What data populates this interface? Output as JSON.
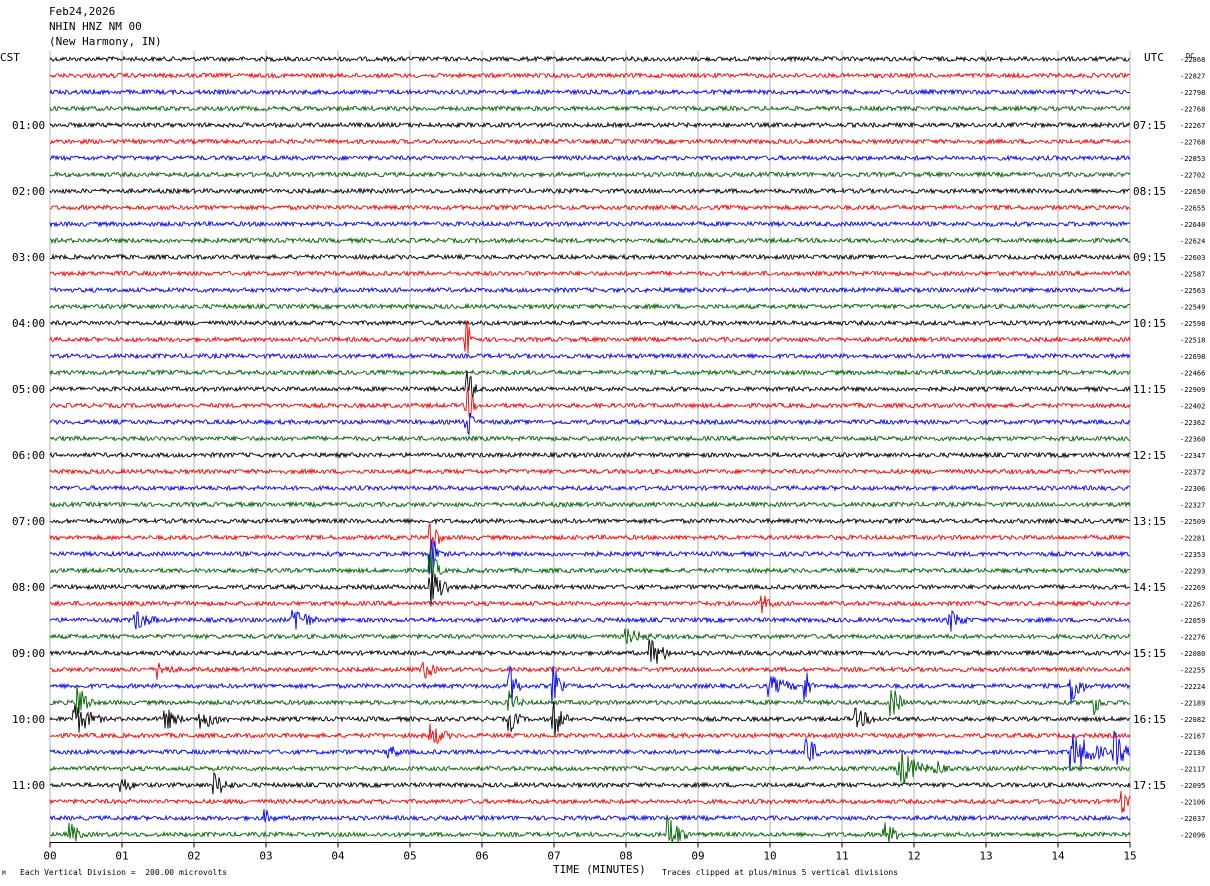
{
  "header": {
    "date": "Feb24,2026",
    "station": "NHIN HNZ NM 00",
    "location": "(New Harmony, IN)"
  },
  "left_zone_label": "CST",
  "right_zone_label": "UTC",
  "dc_label": "DC",
  "footer": {
    "scale_note": "Each Vertical Division =  200.00 microvolts",
    "clip_note": "Traces clipped at plus/minus 5 vertical divisions",
    "corner_mark": "M"
  },
  "colors": {
    "trace_cycle": [
      "#000000",
      "#ff0000",
      "#0000ff",
      "#006400"
    ],
    "grid": "#a0a0a0"
  },
  "chart_data": {
    "type": "line",
    "subtype": "helicorder",
    "xlabel": "TIME (MINUTES)",
    "xlim": [
      0,
      15
    ],
    "x_tick_labels": [
      "00",
      "01",
      "02",
      "03",
      "04",
      "05",
      "06",
      "07",
      "08",
      "09",
      "10",
      "11",
      "12",
      "13",
      "14",
      "15"
    ],
    "rows_per_hour": 4,
    "minutes_per_row": 15,
    "left_time_labels": [
      {
        "row": 4,
        "label": "01:00"
      },
      {
        "row": 8,
        "label": "02:00"
      },
      {
        "row": 12,
        "label": "03:00"
      },
      {
        "row": 16,
        "label": "04:00"
      },
      {
        "row": 20,
        "label": "05:00"
      },
      {
        "row": 24,
        "label": "06:00"
      },
      {
        "row": 28,
        "label": "07:00"
      },
      {
        "row": 32,
        "label": "08:00"
      },
      {
        "row": 36,
        "label": "09:00"
      },
      {
        "row": 40,
        "label": "10:00"
      },
      {
        "row": 44,
        "label": "11:00"
      }
    ],
    "right_time_labels": [
      {
        "row": 4,
        "label": "07:15"
      },
      {
        "row": 8,
        "label": "08:15"
      },
      {
        "row": 12,
        "label": "09:15"
      },
      {
        "row": 16,
        "label": "10:15"
      },
      {
        "row": 20,
        "label": "11:15"
      },
      {
        "row": 24,
        "label": "12:15"
      },
      {
        "row": 28,
        "label": "13:15"
      },
      {
        "row": 32,
        "label": "14:15"
      },
      {
        "row": 36,
        "label": "15:15"
      },
      {
        "row": 40,
        "label": "16:15"
      },
      {
        "row": 44,
        "label": "17:15"
      }
    ],
    "dc_offsets": [
      "-22868",
      "-22827",
      "-22798",
      "-22768",
      "-22267",
      "-22768",
      "-22853",
      "-22702",
      "-22650",
      "-22655",
      "-22640",
      "-22624",
      "-22603",
      "-22587",
      "-22563",
      "-22549",
      "-22598",
      "-22518",
      "-22698",
      "-22466",
      "-22909",
      "-22402",
      "-22362",
      "-22360",
      "-22347",
      "-22372",
      "-22306",
      "-22327",
      "-22509",
      "-22281",
      "-22353",
      "-22293",
      "-22269",
      "-22267",
      "-22059",
      "-22276",
      "-22080",
      "-22255",
      "-22224",
      "-22189",
      "-22082",
      "-22167",
      "-22136",
      "-22117",
      "-22095",
      "-22106",
      "-22037",
      "-22096"
    ],
    "events": [
      {
        "row": 17,
        "minute": 5.8,
        "amp_div": 5,
        "dur_min": 0.12
      },
      {
        "row": 20,
        "minute": 5.8,
        "amp_div": 5,
        "dur_min": 0.15
      },
      {
        "row": 21,
        "minute": 5.8,
        "amp_div": 5,
        "dur_min": 0.12
      },
      {
        "row": 22,
        "minute": 5.8,
        "amp_div": 5,
        "dur_min": 0.1
      },
      {
        "row": 29,
        "minute": 5.3,
        "amp_div": 5,
        "dur_min": 0.15
      },
      {
        "row": 30,
        "minute": 5.3,
        "amp_div": 5,
        "dur_min": 0.15
      },
      {
        "row": 31,
        "minute": 5.3,
        "amp_div": 5,
        "dur_min": 0.15
      },
      {
        "row": 32,
        "minute": 5.3,
        "amp_div": 5,
        "dur_min": 0.3
      },
      {
        "row": 33,
        "minute": 9.9,
        "amp_div": 2.5,
        "dur_min": 0.2
      },
      {
        "row": 34,
        "minute": 1.2,
        "amp_div": 2.5,
        "dur_min": 0.4
      },
      {
        "row": 34,
        "minute": 3.4,
        "amp_div": 4,
        "dur_min": 0.3
      },
      {
        "row": 34,
        "minute": 12.5,
        "amp_div": 3,
        "dur_min": 0.3
      },
      {
        "row": 35,
        "minute": 8.0,
        "amp_div": 2,
        "dur_min": 0.6
      },
      {
        "row": 36,
        "minute": 8.35,
        "amp_div": 4,
        "dur_min": 0.3
      },
      {
        "row": 37,
        "minute": 1.5,
        "amp_div": 2.5,
        "dur_min": 0.3
      },
      {
        "row": 37,
        "minute": 5.2,
        "amp_div": 3,
        "dur_min": 0.2
      },
      {
        "row": 38,
        "minute": 6.4,
        "amp_div": 5,
        "dur_min": 0.15
      },
      {
        "row": 38,
        "minute": 7.0,
        "amp_div": 5,
        "dur_min": 0.15
      },
      {
        "row": 38,
        "minute": 10.0,
        "amp_div": 2.5,
        "dur_min": 0.5
      },
      {
        "row": 38,
        "minute": 10.5,
        "amp_div": 5,
        "dur_min": 0.1
      },
      {
        "row": 38,
        "minute": 14.2,
        "amp_div": 5,
        "dur_min": 0.2
      },
      {
        "row": 39,
        "minute": 0.4,
        "amp_div": 5,
        "dur_min": 0.2
      },
      {
        "row": 39,
        "minute": 6.4,
        "amp_div": 3,
        "dur_min": 0.2
      },
      {
        "row": 39,
        "minute": 11.7,
        "amp_div": 4,
        "dur_min": 0.2
      },
      {
        "row": 39,
        "minute": 14.5,
        "amp_div": 3,
        "dur_min": 0.2
      },
      {
        "row": 40,
        "minute": 0.35,
        "amp_div": 4,
        "dur_min": 0.4
      },
      {
        "row": 40,
        "minute": 1.6,
        "amp_div": 3,
        "dur_min": 0.3
      },
      {
        "row": 40,
        "minute": 2.1,
        "amp_div": 2.5,
        "dur_min": 0.5
      },
      {
        "row": 40,
        "minute": 6.4,
        "amp_div": 3,
        "dur_min": 0.2
      },
      {
        "row": 40,
        "minute": 7.0,
        "amp_div": 5,
        "dur_min": 0.2
      },
      {
        "row": 40,
        "minute": 11.2,
        "amp_div": 2.5,
        "dur_min": 0.4
      },
      {
        "row": 41,
        "minute": 5.3,
        "amp_div": 3,
        "dur_min": 0.3
      },
      {
        "row": 42,
        "minute": 4.7,
        "amp_div": 2,
        "dur_min": 0.3
      },
      {
        "row": 42,
        "minute": 10.5,
        "amp_div": 5,
        "dur_min": 0.2
      },
      {
        "row": 42,
        "minute": 14.2,
        "amp_div": 5,
        "dur_min": 0.5
      },
      {
        "row": 42,
        "minute": 14.8,
        "amp_div": 5,
        "dur_min": 0.2
      },
      {
        "row": 43,
        "minute": 11.8,
        "amp_div": 5,
        "dur_min": 0.4
      },
      {
        "row": 43,
        "minute": 12.3,
        "amp_div": 2.5,
        "dur_min": 0.2
      },
      {
        "row": 44,
        "minute": 1.0,
        "amp_div": 2,
        "dur_min": 0.3
      },
      {
        "row": 44,
        "minute": 2.3,
        "amp_div": 3,
        "dur_min": 0.3
      },
      {
        "row": 45,
        "minute": 14.9,
        "amp_div": 3,
        "dur_min": 0.2
      },
      {
        "row": 46,
        "minute": 3.0,
        "amp_div": 2,
        "dur_min": 0.2
      },
      {
        "row": 47,
        "minute": 0.3,
        "amp_div": 3,
        "dur_min": 0.2
      },
      {
        "row": 47,
        "minute": 8.6,
        "amp_div": 5,
        "dur_min": 0.25
      },
      {
        "row": 47,
        "minute": 11.6,
        "amp_div": 3,
        "dur_min": 0.3
      }
    ],
    "grid": true
  }
}
